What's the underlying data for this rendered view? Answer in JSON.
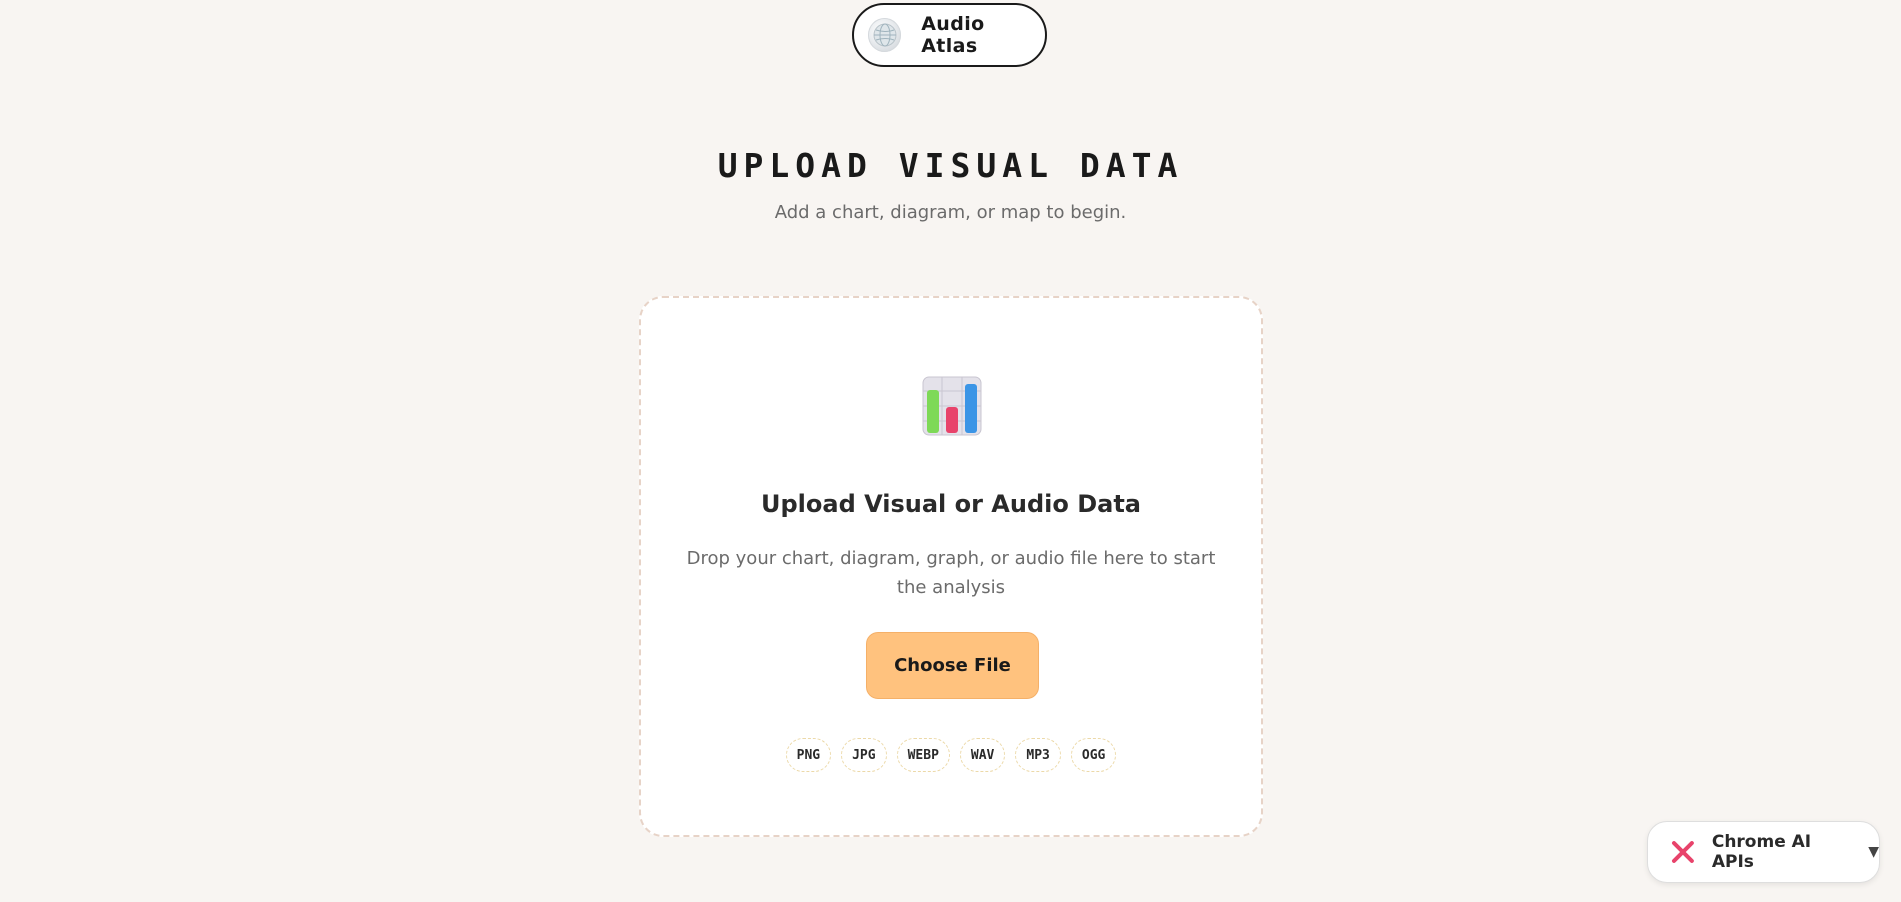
{
  "brand": {
    "name": "Audio Atlas",
    "logo_icon": "globe-logo-icon"
  },
  "heading": {
    "title": "UPLOAD VISUAL DATA",
    "subtitle": "Add a chart, diagram, or map to begin."
  },
  "upload_card": {
    "icon": "bar-chart-icon",
    "title": "Upload Visual or Audio Data",
    "description": "Drop your chart, diagram, graph, or audio file here to start the analysis",
    "button_label": "Choose File",
    "formats": [
      "PNG",
      "JPG",
      "WEBP",
      "WAV",
      "MP3",
      "OGG"
    ]
  },
  "ai_widget": {
    "label": "Chrome AI APIs",
    "status_icon": "close-icon",
    "caret": "▼"
  },
  "colors": {
    "background": "#f8f5f2",
    "button": "#ffc27e",
    "status_red": "#e8436b"
  }
}
